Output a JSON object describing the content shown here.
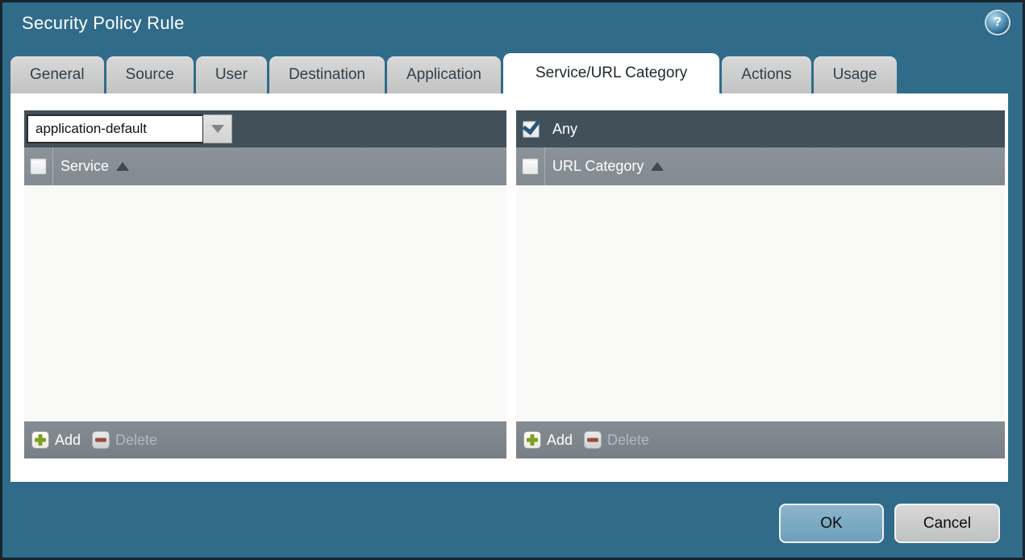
{
  "window": {
    "title": "Security Policy Rule",
    "help_icon_glyph": "?"
  },
  "tabs": [
    {
      "label": "General",
      "active": false
    },
    {
      "label": "Source",
      "active": false
    },
    {
      "label": "User",
      "active": false
    },
    {
      "label": "Destination",
      "active": false
    },
    {
      "label": "Application",
      "active": false
    },
    {
      "label": "Service/URL Category",
      "active": true
    },
    {
      "label": "Actions",
      "active": false
    },
    {
      "label": "Usage",
      "active": false
    }
  ],
  "service_panel": {
    "dropdown": {
      "value": "application-default"
    },
    "select_all_checked": false,
    "column_header": "Service",
    "sort_direction": "asc",
    "rows": [],
    "toolbar": {
      "add_label": "Add",
      "delete_label": "Delete",
      "delete_enabled": false
    }
  },
  "url_category_panel": {
    "any": {
      "label": "Any",
      "checked": true
    },
    "select_all_checked": false,
    "column_header": "URL Category",
    "sort_direction": "asc",
    "rows": [],
    "toolbar": {
      "add_label": "Add",
      "delete_label": "Delete",
      "delete_enabled": false
    }
  },
  "footer": {
    "ok_label": "OK",
    "cancel_label": "Cancel"
  },
  "colors": {
    "background": "#306b8a",
    "outer_border": "#16242d",
    "panel_header": "#42505a",
    "column_header": "#878f96",
    "toolbar_bar": "#7e868d",
    "content_bg": "#f9f9f8",
    "tab_inactive": "#c9c9c9",
    "tab_active": "#ffffff",
    "ok_button": "#74a6c1",
    "cancel_button": "#c9cacb",
    "add_icon_green": "#7da01d",
    "delete_icon_red": "#9c4a38",
    "checkmark_blue": "#27597a"
  }
}
